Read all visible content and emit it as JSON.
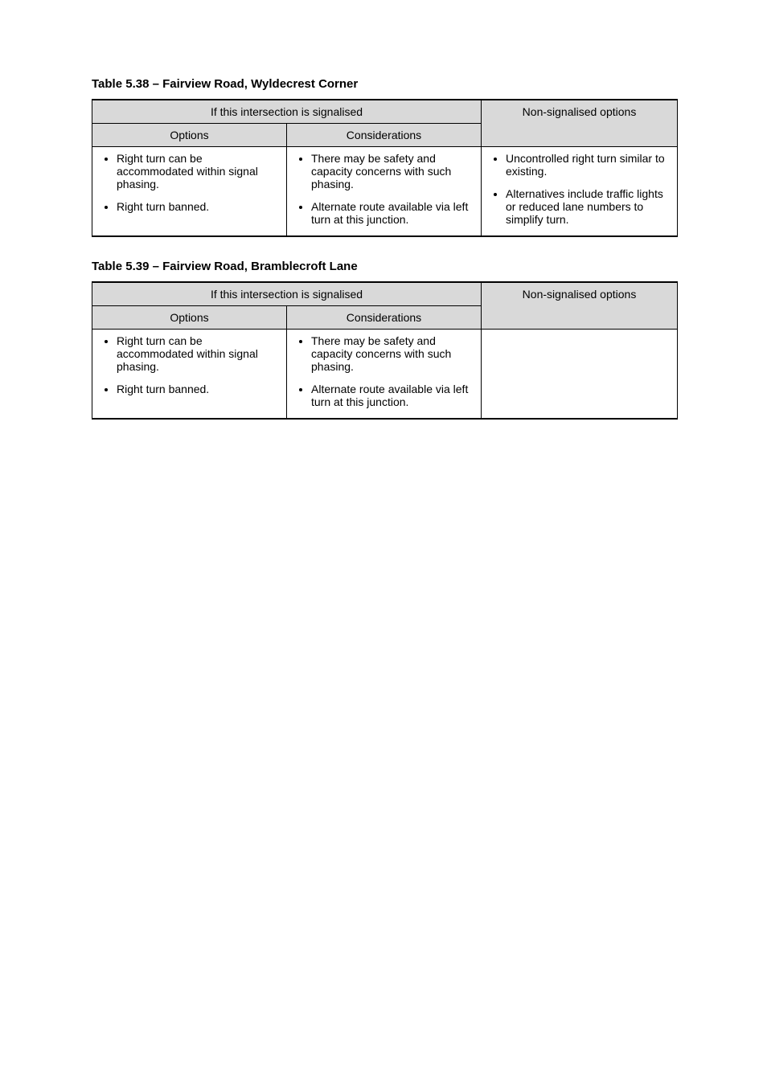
{
  "tables": [
    {
      "title": "Table 5.38 – Fairview Road, Wyldecrest Corner",
      "header_span": "If this intersection is signalised",
      "header_single": "Non-signalised options",
      "sub_left": "Options",
      "sub_right": "Considerations",
      "col1": [
        "Right turn can be accommodated within signal phasing.",
        "Right turn banned."
      ],
      "col2": [
        "There may be safety and capacity concerns with such phasing.",
        "Alternate route available via left turn at this junction."
      ],
      "col3": [
        "Uncontrolled right turn similar to existing.",
        "Alternatives include traffic lights or reduced lane numbers to simplify turn."
      ]
    },
    {
      "title": "Table 5.39 – Fairview Road, Bramblecroft Lane",
      "header_span": "If this intersection is signalised",
      "header_single": "Non-signalised options",
      "sub_left": "Options",
      "sub_right": "Considerations",
      "col1": [
        "Right turn can be accommodated within signal phasing.",
        "Right turn banned."
      ],
      "col2": [
        "There may be safety and capacity concerns with such phasing.",
        "Alternate route available via left turn at this junction."
      ],
      "col3": []
    }
  ]
}
